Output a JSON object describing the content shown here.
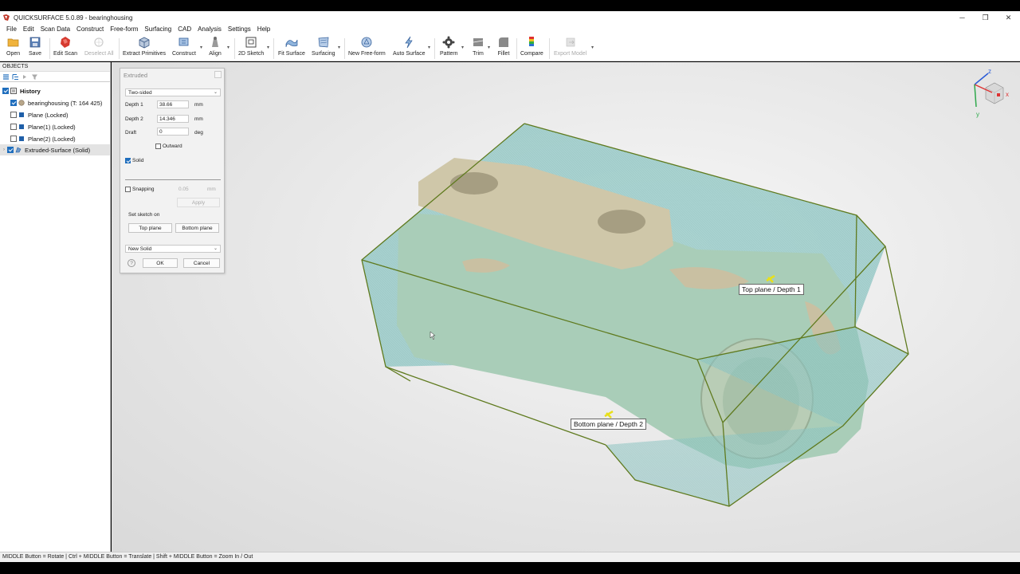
{
  "window": {
    "title": "QUICKSURFACE 5.0.89 - bearinghousing",
    "minimize_glyph": "─",
    "maximize_glyph": "❐",
    "close_glyph": "✕"
  },
  "menu": [
    "File",
    "Edit",
    "Scan Data",
    "Construct",
    "Free-form",
    "Surfacing",
    "CAD",
    "Analysis",
    "Settings",
    "Help"
  ],
  "toolbar": {
    "open": "Open",
    "save": "Save",
    "edit_scan": "Edit Scan",
    "deselect_all": "Deselect All",
    "extract_primitives": "Extract Primitives",
    "construct": "Construct",
    "align": "Align",
    "sketch_2d": "2D Sketch",
    "fit_surface": "Fit Surface",
    "surfacing": "Surfacing",
    "new_freeform": "New Free-form",
    "auto_surface": "Auto Surface",
    "pattern": "Pattern",
    "trim": "Trim",
    "fillet": "Fillet",
    "compare": "Compare",
    "export_model": "Export Model"
  },
  "sidebar": {
    "header": "OBJECTS",
    "items": [
      {
        "label": "History"
      },
      {
        "label": "bearinghousing (T: 164 425)"
      },
      {
        "label": "Plane (Locked)"
      },
      {
        "label": "Plane(1) (Locked)"
      },
      {
        "label": "Plane(2) (Locked)"
      },
      {
        "label": "Extruded-Surface (Solid)"
      }
    ]
  },
  "dialog": {
    "title": "Extruded",
    "mode": "Two-sided",
    "depth1_label": "Depth 1",
    "depth1_value": "38.66",
    "depth1_unit": "mm",
    "depth2_label": "Depth 2",
    "depth2_value": "14.346",
    "depth2_unit": "mm",
    "draft_label": "Draft",
    "draft_value": "0",
    "draft_unit": "deg",
    "outward_label": "Outward",
    "outward_checked": false,
    "solid_label": "Solid",
    "solid_checked": true,
    "snapping_label": "Snapping",
    "snapping_checked": false,
    "snapping_value": "0.05",
    "snapping_unit": "mm",
    "apply_label": "Apply",
    "set_sketch_label": "Set sketch on",
    "top_plane_label": "Top plane",
    "bottom_plane_label": "Bottom plane",
    "output_mode": "New Solid",
    "ok_label": "OK",
    "cancel_label": "Cancel",
    "help_glyph": "?"
  },
  "viewport": {
    "tooltip_top": "Top plane / Depth 1",
    "tooltip_bottom": "Bottom plane / Depth 2",
    "axis_x": "x",
    "axis_y": "y",
    "axis_z": "z"
  },
  "statusbar": {
    "text": "MIDDLE Button = Rotate | Ctrl + MIDDLE Button = Translate | Shift + MIDDLE Button = Zoom In / Out"
  },
  "colors": {
    "accent": "#1f6ebd",
    "extrude_fill": "#8fc7c4",
    "extrude_edge": "#5f7a1e",
    "scan_tan": "#c9c4a6",
    "scan_green": "#9ec6b0"
  }
}
